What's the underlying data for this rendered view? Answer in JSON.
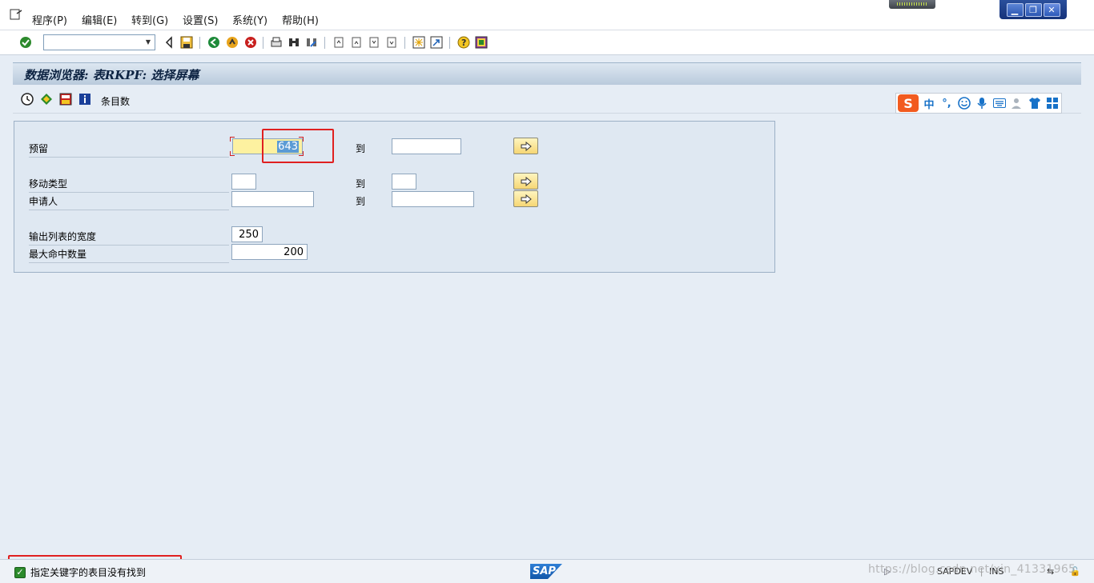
{
  "menu": {
    "items": [
      "程序(P)",
      "编辑(E)",
      "转到(G)",
      "设置(S)",
      "系统(Y)",
      "帮助(H)"
    ]
  },
  "window": {
    "minimize": "▁",
    "restore": "❐",
    "close": "✕"
  },
  "screen": {
    "title": "数据浏览器: 表RKPF: 选择屏幕",
    "app_toolbar_label": "条目数"
  },
  "form": {
    "rows": [
      {
        "label": "预留",
        "low": "643",
        "to": "到",
        "high": ""
      },
      {
        "label": "移动类型",
        "low": "",
        "to": "到",
        "high": ""
      },
      {
        "label": "申请人",
        "low": "",
        "to": "到",
        "high": ""
      }
    ],
    "width_label": "输出列表的宽度",
    "width_value": "250",
    "max_label": "最大命中数量",
    "max_value": "200"
  },
  "ime": {
    "logo": "S",
    "mode": "中",
    "punct": "°,"
  },
  "status": {
    "message": "指定关键字的表目没有找到",
    "system": "SAPDEV",
    "mode": "INS",
    "logo": "SAP"
  },
  "watermark": "https://blog.csdn.net/xin_41331965"
}
